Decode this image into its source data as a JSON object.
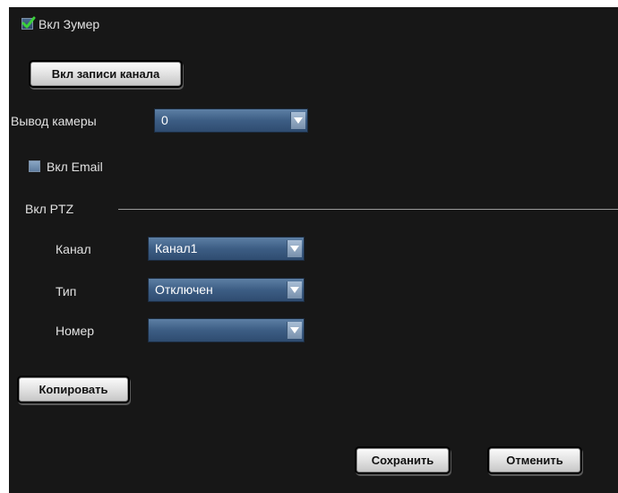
{
  "zoom_checkbox": {
    "label": "Вкл Зумер",
    "checked": true
  },
  "channel_record_button": {
    "label": "Вкл записи канала"
  },
  "camera_output": {
    "label": "Вывод камеры",
    "value": "0"
  },
  "email_checkbox": {
    "label": "Вкл Email",
    "checked": false
  },
  "ptz": {
    "section_label": "Вкл PTZ",
    "channel": {
      "label": "Канал",
      "value": "Канал1"
    },
    "type": {
      "label": "Тип",
      "value": "Отключен"
    },
    "number": {
      "label": "Номер",
      "value": ""
    }
  },
  "copy_button": {
    "label": "Копировать"
  },
  "footer": {
    "save_label": "Сохранить",
    "cancel_label": "Отменить"
  },
  "colors": {
    "background": "#171717",
    "select_blue": "#3c5d84",
    "checkmark_green": "#3bd13b"
  },
  "icons": {
    "checkbox_check": "check-icon",
    "dropdown_arrow": "chevron-down-icon"
  }
}
